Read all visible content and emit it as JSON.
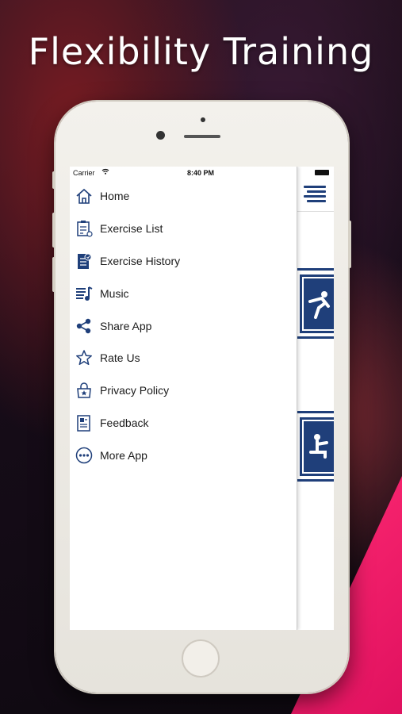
{
  "headline": "Flexibility Training",
  "status_bar": {
    "carrier": "Carrier",
    "time": "8:40 PM"
  },
  "menu": {
    "items": [
      {
        "label": "Home",
        "icon": "home-icon"
      },
      {
        "label": "Exercise List",
        "icon": "clipboard-list-icon"
      },
      {
        "label": "Exercise History",
        "icon": "history-notebook-icon"
      },
      {
        "label": "Music",
        "icon": "music-icon"
      },
      {
        "label": "Share App",
        "icon": "share-icon"
      },
      {
        "label": "Rate Us",
        "icon": "star-icon"
      },
      {
        "label": "Privacy Policy",
        "icon": "privacy-lock-icon"
      },
      {
        "label": "Feedback",
        "icon": "feedback-icon"
      },
      {
        "label": "More App",
        "icon": "more-dots-icon"
      }
    ]
  },
  "colors": {
    "accent": "#1f3f7a",
    "pink": "#ff2a73"
  }
}
